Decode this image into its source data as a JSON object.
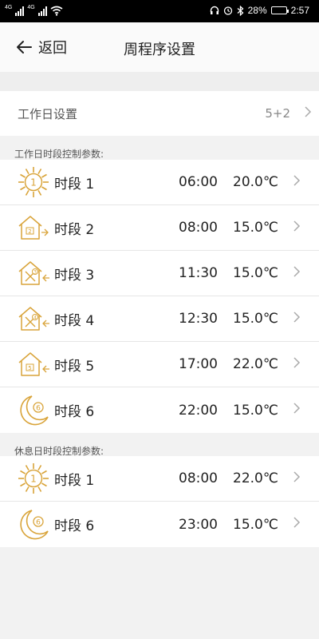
{
  "status_bar": {
    "left_tags": [
      "4G",
      "4G"
    ],
    "battery": "28%",
    "battery_level": 0.28,
    "time": "2:57",
    "icons": [
      "headphones-icon",
      "alarm-icon",
      "bluetooth-icon",
      "battery-icon"
    ]
  },
  "nav": {
    "back_label": "返回",
    "title": "周程序设置"
  },
  "workday_setting": {
    "label": "工作日设置",
    "value": "5+2"
  },
  "workday_section": {
    "header": "工作日时段控制参数:",
    "rows": [
      {
        "icon": "sun-icon",
        "num": "1",
        "label": "时段 1",
        "time": "06:00",
        "temp": "20.0℃"
      },
      {
        "icon": "house-leave-icon",
        "num": "2",
        "label": "时段 2",
        "time": "08:00",
        "temp": "15.0℃"
      },
      {
        "icon": "house-meal-icon",
        "num": "3",
        "label": "时段 3",
        "time": "11:30",
        "temp": "15.0℃"
      },
      {
        "icon": "house-meal-icon",
        "num": "4",
        "label": "时段 4",
        "time": "12:30",
        "temp": "15.0℃"
      },
      {
        "icon": "house-return-icon",
        "num": "5",
        "label": "时段 5",
        "time": "17:00",
        "temp": "22.0℃"
      },
      {
        "icon": "moon-icon",
        "num": "6",
        "label": "时段 6",
        "time": "22:00",
        "temp": "15.0℃"
      }
    ]
  },
  "restday_section": {
    "header": "休息日时段控制参数:",
    "rows": [
      {
        "icon": "sun-icon",
        "num": "1",
        "label": "时段 1",
        "time": "08:00",
        "temp": "22.0℃"
      },
      {
        "icon": "moon-icon",
        "num": "6",
        "label": "时段 6",
        "time": "23:00",
        "temp": "15.0℃"
      }
    ]
  },
  "colors": {
    "accent": "#d9a43a",
    "row_bg": "#ffffff",
    "page_bg": "#f2f2f2"
  }
}
